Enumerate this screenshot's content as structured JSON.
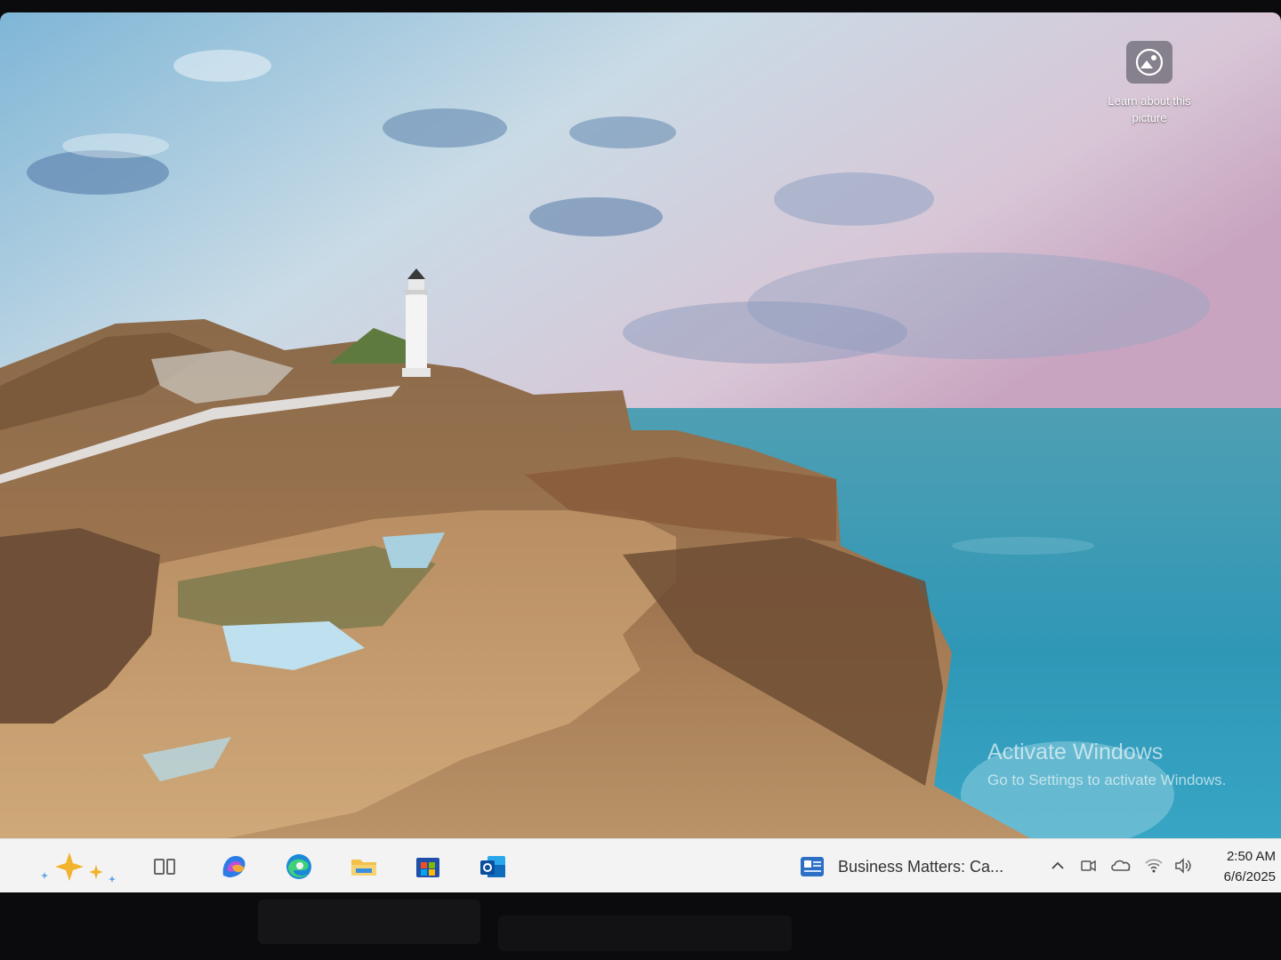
{
  "desktop": {
    "spotlight_label": "Learn about this picture",
    "watermark": {
      "title": "Activate Windows",
      "subtitle": "Go to Settings to activate Windows."
    }
  },
  "taskbar": {
    "pinned": [
      {
        "icon": "sparkle-icon"
      },
      {
        "icon": "task-view-icon"
      },
      {
        "icon": "copilot-icon"
      },
      {
        "icon": "edge-icon"
      },
      {
        "icon": "file-explorer-icon"
      },
      {
        "icon": "microsoft-store-icon"
      },
      {
        "icon": "outlook-icon"
      }
    ],
    "news": {
      "icon": "news-icon",
      "text": "Business Matters: Ca..."
    },
    "tray": [
      "chevron-up-icon",
      "meet-now-icon",
      "onedrive-icon",
      "wifi-icon",
      "volume-icon"
    ],
    "clock": {
      "time": "2:50 AM",
      "date": "6/6/2025"
    }
  }
}
